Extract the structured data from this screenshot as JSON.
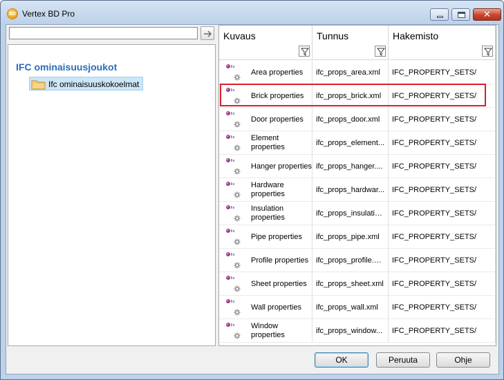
{
  "window": {
    "title": "Vertex BD Pro",
    "app_icon_text": "BD",
    "close_glyph": "✕"
  },
  "search": {
    "value": "",
    "placeholder": ""
  },
  "tree": {
    "header": "IFC ominaisuusjoukot",
    "items": [
      {
        "label": "Ifc ominaisuuskokoelmat",
        "selected": true
      }
    ]
  },
  "grid": {
    "columns": [
      {
        "label": "Kuvaus"
      },
      {
        "label": "Tunnus"
      },
      {
        "label": "Hakemisto"
      }
    ],
    "rows": [
      {
        "desc": "Area properties",
        "id": "ifc_props_area.xml",
        "dir": "IFC_PROPERTY_SETS/"
      },
      {
        "desc": "Brick properties",
        "id": "ifc_props_brick.xml",
        "dir": "IFC_PROPERTY_SETS/",
        "highlighted": true
      },
      {
        "desc": "Door properties",
        "id": "ifc_props_door.xml",
        "dir": "IFC_PROPERTY_SETS/"
      },
      {
        "desc": "Element properties",
        "id": "ifc_props_element...",
        "dir": "IFC_PROPERTY_SETS/"
      },
      {
        "desc": "Hanger properties",
        "id": "ifc_props_hanger....",
        "dir": "IFC_PROPERTY_SETS/"
      },
      {
        "desc": "Hardware properties",
        "id": "ifc_props_hardwar...",
        "dir": "IFC_PROPERTY_SETS/"
      },
      {
        "desc": "Insulation properties",
        "id": "ifc_props_insulatio...",
        "dir": "IFC_PROPERTY_SETS/"
      },
      {
        "desc": "Pipe properties",
        "id": "ifc_props_pipe.xml",
        "dir": "IFC_PROPERTY_SETS/"
      },
      {
        "desc": "Profile properties",
        "id": "ifc_props_profile.xml",
        "dir": "IFC_PROPERTY_SETS/"
      },
      {
        "desc": "Sheet properties",
        "id": "ifc_props_sheet.xml",
        "dir": "IFC_PROPERTY_SETS/"
      },
      {
        "desc": "Wall properties",
        "id": "ifc_props_wall.xml",
        "dir": "IFC_PROPERTY_SETS/"
      },
      {
        "desc": "Window properties",
        "id": "ifc_props_window...",
        "dir": "IFC_PROPERTY_SETS/"
      }
    ]
  },
  "buttons": {
    "ok": "OK",
    "cancel": "Peruuta",
    "help": "Ohje"
  },
  "icons": {
    "app": "vertex-logo-icon",
    "go": "arrow-right-icon",
    "folder": "folder-icon",
    "filter": "filter-icon",
    "row": "property-set-icon"
  },
  "colors": {
    "accent": "#2a6cb8",
    "selection": "#cde6f7",
    "highlight": "#d81f2a"
  }
}
